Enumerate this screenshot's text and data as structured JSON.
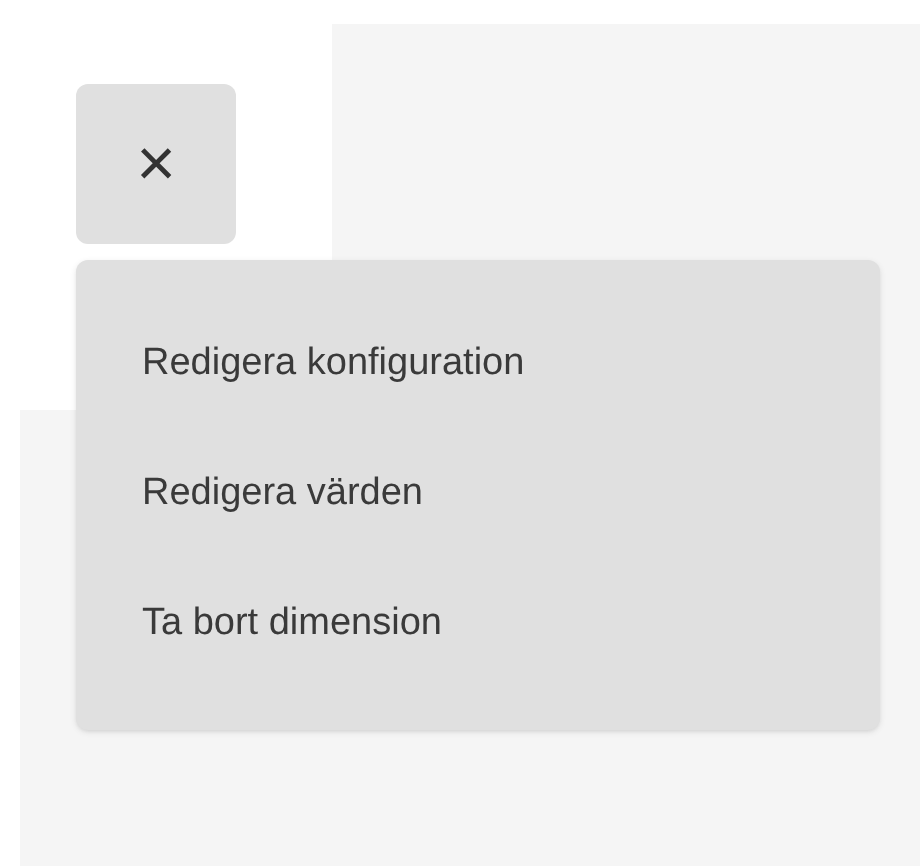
{
  "close_button": {
    "label": "×"
  },
  "menu": {
    "items": [
      {
        "label": "Redigera konfiguration"
      },
      {
        "label": "Redigera värden"
      },
      {
        "label": "Ta bort dimension"
      }
    ]
  }
}
